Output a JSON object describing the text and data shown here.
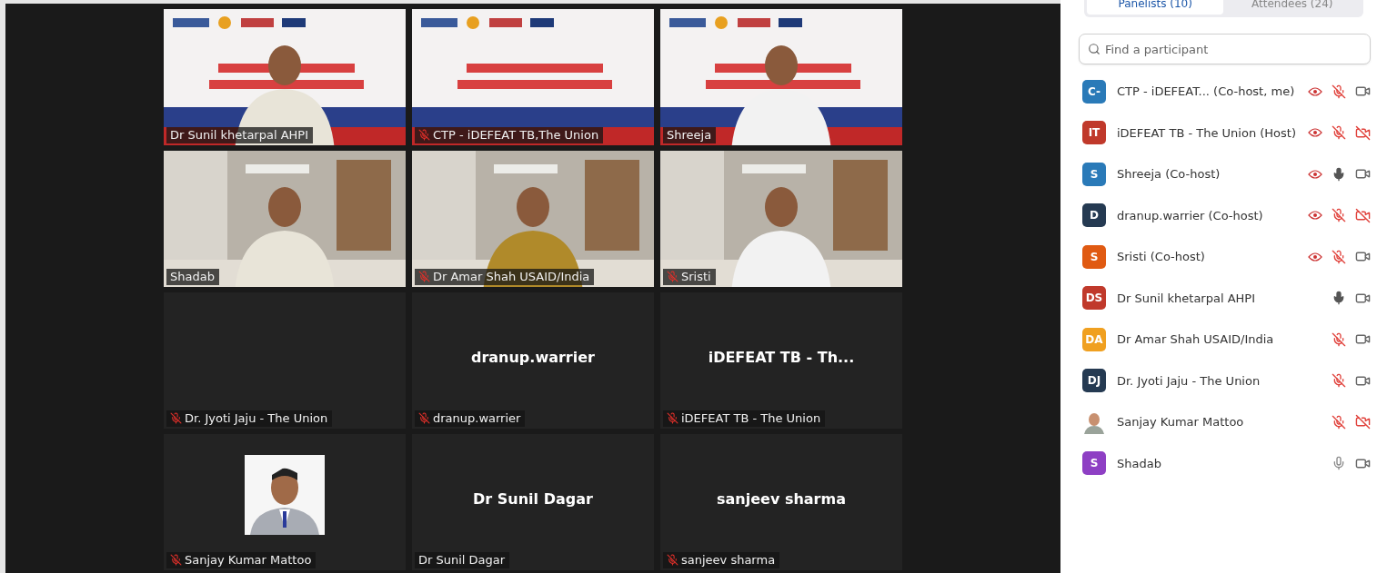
{
  "gallery": {
    "tiles": [
      {
        "kind": "slide",
        "label": "Dr Sunil khetarpal AHPI",
        "muted": false,
        "speaking": true
      },
      {
        "kind": "screen",
        "label": "CTP - iDEFEAT TB,The Union",
        "muted": true,
        "speaking": false
      },
      {
        "kind": "slide",
        "label": "Shreeja",
        "muted": false,
        "speaking": false
      },
      {
        "kind": "room",
        "label": "Shadab",
        "muted": false,
        "speaking": false
      },
      {
        "kind": "room",
        "label": "Dr Amar Shah USAID/India",
        "muted": true,
        "speaking": false
      },
      {
        "kind": "room",
        "label": "Sristi",
        "muted": true,
        "speaking": false
      },
      {
        "kind": "blank",
        "label": "Dr. Jyoti Jaju - The Union",
        "muted": true,
        "speaking": false
      },
      {
        "kind": "name",
        "display_name": "dranup.warrier",
        "label": "dranup.warrier",
        "muted": true,
        "speaking": false
      },
      {
        "kind": "name",
        "display_name": "iDEFEAT TB - Th...",
        "label": "iDEFEAT TB - The Union",
        "muted": true,
        "speaking": false
      },
      {
        "label": "Sanjay Kumar Mattoo",
        "muted": true,
        "speaking": false
      },
      {
        "kind": "name",
        "display_name": "Dr Sunil Dagar",
        "label": "Dr Sunil Dagar",
        "muted": false,
        "speaking": false
      },
      {
        "kind": "name",
        "display_name": "sanjeev sharma",
        "label": "sanjeev sharma",
        "muted": true,
        "speaking": false
      }
    ]
  },
  "participants_panel": {
    "tabs": [
      {
        "label": "Panelists (10)",
        "selected": true
      },
      {
        "label": "Attendees (24)",
        "selected": false
      }
    ],
    "search": {
      "placeholder": "Find a participant"
    },
    "participants": [
      {
        "kind": "initials",
        "initials": "C-",
        "color": "#2a7ab8",
        "name": "CTP - iDEFEAT... (Co-host, me)",
        "sharing": true,
        "mic_muted": true,
        "video_off": false
      },
      {
        "kind": "initials",
        "initials": "IT",
        "color": "#c0392b",
        "name": "iDEFEAT TB - The Union (Host)",
        "sharing": true,
        "mic_muted": true,
        "video_off": true
      },
      {
        "kind": "initials",
        "initials": "S",
        "color": "#2a7ab8",
        "name": "Shreeja (Co-host)",
        "sharing": true,
        "mic_muted": false,
        "mic_active": true,
        "video_off": false
      },
      {
        "kind": "initials",
        "initials": "D",
        "color": "#253a52",
        "name": "dranup.warrier (Co-host)",
        "sharing": true,
        "mic_muted": true,
        "video_off": true
      },
      {
        "kind": "initials",
        "initials": "S",
        "color": "#e05a12",
        "name": "Sristi (Co-host)",
        "sharing": true,
        "mic_muted": true,
        "video_off": false
      },
      {
        "kind": "initials",
        "initials": "DS",
        "color": "#c0392b",
        "name": "Dr Sunil khetarpal AHPI",
        "sharing": false,
        "mic_muted": false,
        "mic_active": true,
        "video_off": false
      },
      {
        "kind": "initials",
        "initials": "DA",
        "color": "#f0a020",
        "name": "Dr Amar Shah USAID/India",
        "sharing": false,
        "mic_muted": true,
        "video_off": false
      },
      {
        "kind": "initials",
        "initials": "DJ",
        "color": "#253a52",
        "name": "Dr. Jyoti Jaju - The Union",
        "sharing": false,
        "mic_muted": true,
        "video_off": false
      },
      {
        "kind": "picture",
        "name": "Sanjay Kumar Mattoo",
        "sharing": false,
        "mic_muted": true,
        "video_off": true
      },
      {
        "kind": "initials",
        "initials": "S",
        "color": "#8e3fc4",
        "name": "Shadab",
        "sharing": false,
        "mic_muted": false,
        "mic_active": false,
        "video_off": false
      }
    ]
  }
}
